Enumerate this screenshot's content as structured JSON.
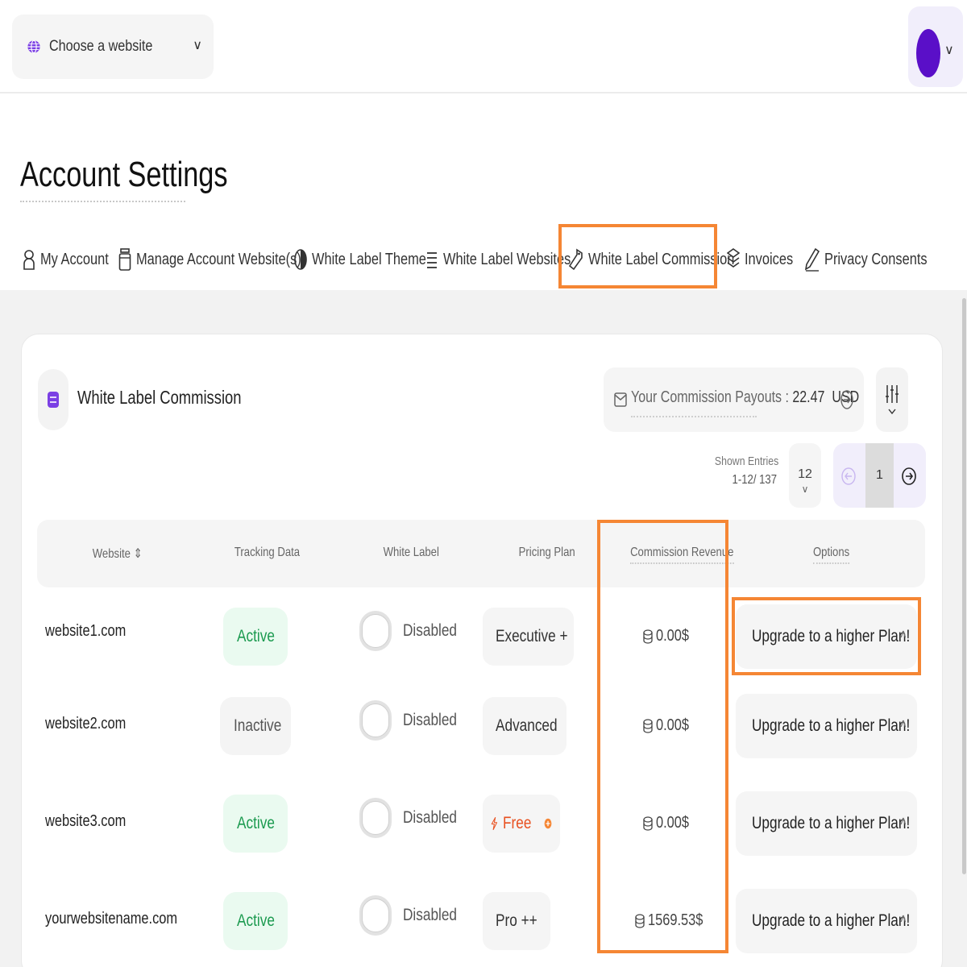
{
  "header": {
    "site_selector_label": "Choose a website"
  },
  "page": {
    "title": "Account Settings"
  },
  "tabs": [
    {
      "label": "My Account",
      "icon": "user-icon"
    },
    {
      "label": "Manage Account Website(s)",
      "icon": "jar-icon"
    },
    {
      "label": "White Label Theme",
      "icon": "contrast-icon"
    },
    {
      "label": "White Label Websites",
      "icon": "list-icon"
    },
    {
      "label": "White Label Commission",
      "icon": "tag-icon"
    },
    {
      "label": "Invoices",
      "icon": "layers-icon"
    },
    {
      "label": "Privacy Consents",
      "icon": "pen-icon"
    }
  ],
  "card": {
    "title": "White Label Commission",
    "payouts_label": "Your Commission Payouts : ",
    "payouts_amount": "22.47",
    "payouts_currency": "USD"
  },
  "pagination": {
    "shown_label": "Shown Entries",
    "shown_range": "1-12/ 137",
    "per_page": "12",
    "current_page": "1"
  },
  "table": {
    "headers": [
      "Website",
      "Tracking Data",
      "White Label",
      "Pricing Plan",
      "Commission Revenue",
      "Options"
    ],
    "rows": [
      {
        "website": "website1.com",
        "tracking": "Active",
        "white_label": "Disabled",
        "plan": "Executive +",
        "revenue": "0.00$",
        "option": "Upgrade to a higher Plan!"
      },
      {
        "website": "website2.com",
        "tracking": "Inactive",
        "white_label": "Disabled",
        "plan": "Advanced",
        "revenue": "0.00$",
        "option": "Upgrade to a higher Plan!"
      },
      {
        "website": "website3.com",
        "tracking": "Active",
        "white_label": "Disabled",
        "plan": "Free",
        "revenue": "0.00$",
        "option": "Upgrade to a higher Plan!"
      },
      {
        "website": "yourwebsitename.com",
        "tracking": "Active",
        "white_label": "Disabled",
        "plan": "Pro ++",
        "revenue": "1569.53$",
        "option": "Upgrade to a higher Plan!"
      }
    ]
  },
  "colors": {
    "accent_orange": "#f58634",
    "avatar_purple": "#5a0fc8",
    "active_green": "#1b9a4f",
    "plan_bolt_orange": "#f07a2a",
    "plan_bolt_blue": "#2d6fe0",
    "plan_bolt_red": "#e8501f"
  }
}
